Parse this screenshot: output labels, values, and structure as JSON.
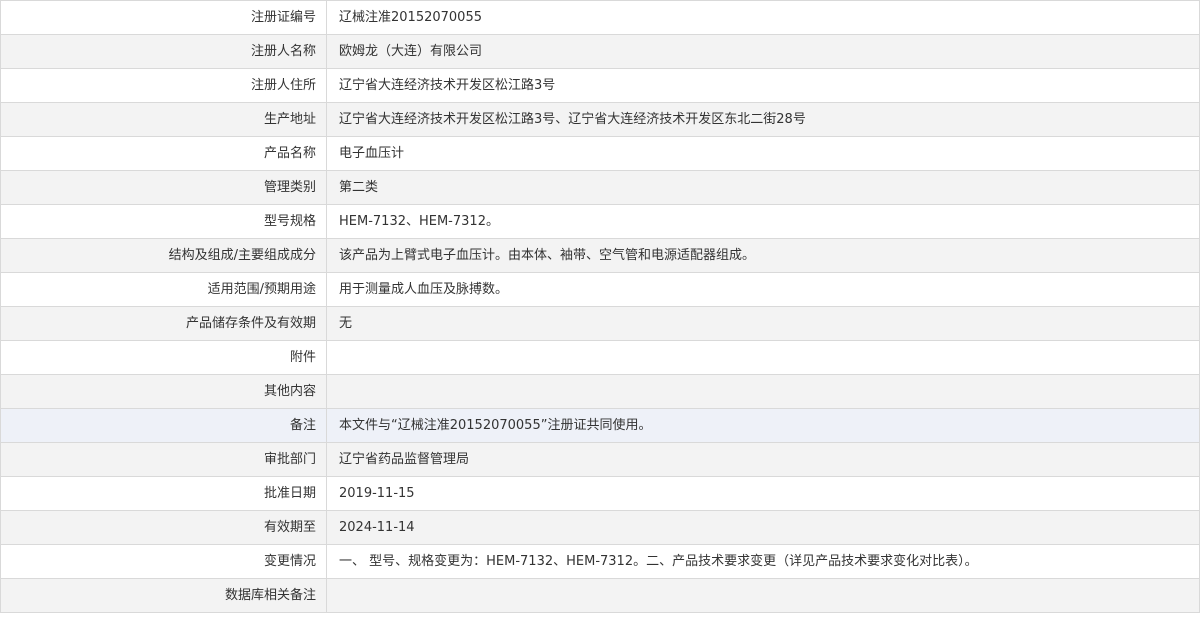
{
  "rows": [
    {
      "label": "注册证编号",
      "value": "辽械注准20152070055"
    },
    {
      "label": "注册人名称",
      "value": "欧姆龙（大连）有限公司"
    },
    {
      "label": "注册人住所",
      "value": "辽宁省大连经济技术开发区松江路3号"
    },
    {
      "label": "生产地址",
      "value": "辽宁省大连经济技术开发区松江路3号、辽宁省大连经济技术开发区东北二街28号"
    },
    {
      "label": "产品名称",
      "value": "电子血压计"
    },
    {
      "label": "管理类别",
      "value": "第二类"
    },
    {
      "label": "型号规格",
      "value": "HEM-7132、HEM-7312。"
    },
    {
      "label": "结构及组成/主要组成成分",
      "value": "该产品为上臂式电子血压计。由本体、袖带、空气管和电源适配器组成。"
    },
    {
      "label": "适用范围/预期用途",
      "value": "用于测量成人血压及脉搏数。"
    },
    {
      "label": "产品储存条件及有效期",
      "value": "无"
    },
    {
      "label": "附件",
      "value": ""
    },
    {
      "label": "其他内容",
      "value": ""
    },
    {
      "label": "备注",
      "value": "本文件与“辽械注准20152070055”注册证共同使用。"
    },
    {
      "label": "审批部门",
      "value": "辽宁省药品监督管理局"
    },
    {
      "label": "批准日期",
      "value": "2019-11-15"
    },
    {
      "label": "有效期至",
      "value": "2024-11-14"
    },
    {
      "label": "变更情况",
      "value": "一、 型号、规格变更为：HEM-7132、HEM-7312。二、产品技术要求变更（详见产品技术要求变化对比表）。"
    },
    {
      "label": "数据库相关备注",
      "value": ""
    }
  ]
}
